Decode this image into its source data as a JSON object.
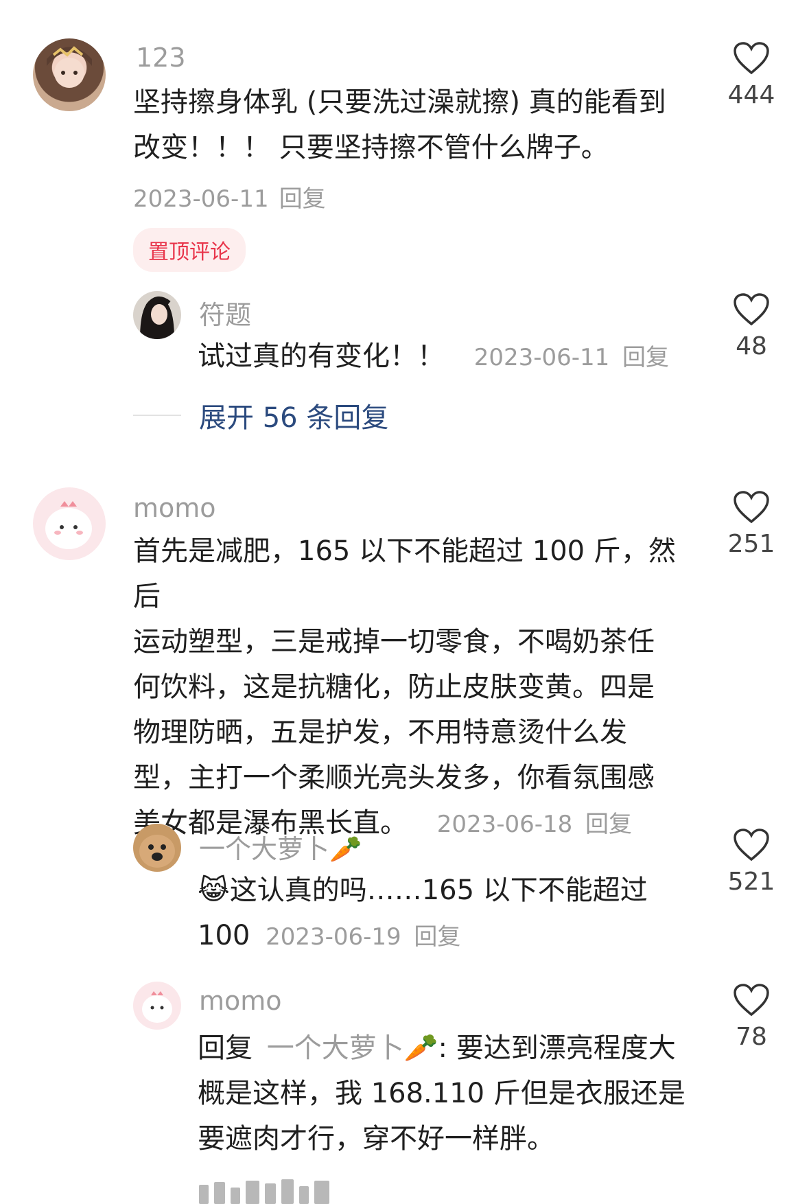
{
  "comments": [
    {
      "username": "123",
      "text_lines": [
        "坚持擦身体乳 (只要洗过澡就擦) 真的能看到",
        "改变！！！ 只要坚持擦不管什么牌子。"
      ],
      "date": "2023-06-11",
      "reply_label": "回复",
      "likes": "444",
      "pinned_label": "置顶评论"
    },
    {
      "username": "符题",
      "text": "试过真的有变化！！",
      "date": "2023-06-11",
      "reply_label": "回复",
      "likes": "48"
    },
    {
      "expand_label": "展开 56 条回复"
    },
    {
      "username": "momo",
      "text_lines": [
        "首先是减肥，165 以下不能超过 100 斤，然后",
        "运动塑型，三是戒掉一切零食，不喝奶茶任",
        "何饮料，这是抗糖化，防止皮肤变黄。四是",
        "物理防晒，五是护发，不用特意烫什么发",
        "型，主打一个柔顺光亮头发多，你看氛围感",
        "美女都是瀑布黑长直。"
      ],
      "date": "2023-06-18",
      "reply_label": "回复",
      "likes": "251"
    },
    {
      "username": "一个大萝卜🥕",
      "text_line1": "😹这认真的吗……165 以下不能超过",
      "text_line2": "100",
      "date": "2023-06-19",
      "reply_label": "回复",
      "likes": "521"
    },
    {
      "username": "momo",
      "reply_prefix": "回复",
      "reply_to": "一个大萝卜🥕",
      "line1_rest": ": 要达到漂亮程度大",
      "line2": "概是这样，我 168.110 斤但是衣服还是",
      "line3": "要遮肉才行，穿不好一样胖。",
      "likes": "78"
    }
  ],
  "colors": {
    "pinned_text": "#e8344a",
    "link": "#2b4a7e",
    "muted": "#9c9c9c"
  }
}
